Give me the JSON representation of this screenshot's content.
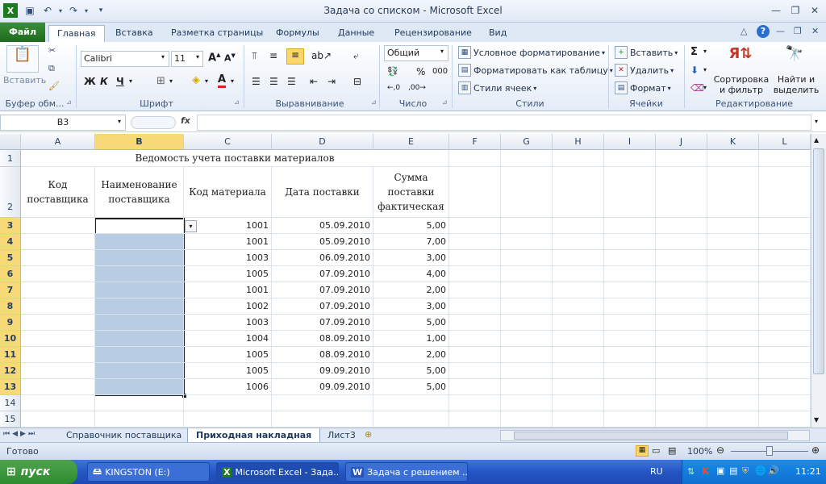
{
  "window": {
    "title": "Задача со списком - Microsoft Excel"
  },
  "tabs": [
    "Файл",
    "Главная",
    "Вставка",
    "Разметка страницы",
    "Формулы",
    "Данные",
    "Рецензирование",
    "Вид"
  ],
  "ribbon": {
    "clipboard": {
      "paste": "Вставить",
      "label": "Буфер обм..."
    },
    "font": {
      "name": "Calibri",
      "size": "11",
      "bold": "Ж",
      "italic": "К",
      "underline": "Ч",
      "label": "Шрифт"
    },
    "alignment": {
      "label": "Выравнивание"
    },
    "number": {
      "format": "Общий",
      "label": "Число"
    },
    "styles": {
      "cond": "Условное форматирование",
      "table": "Форматировать как таблицу",
      "cell": "Стили ячеек",
      "label": "Стили"
    },
    "cells": {
      "insert": "Вставить",
      "delete": "Удалить",
      "format": "Формат",
      "label": "Ячейки"
    },
    "editing": {
      "sort1": "Сортировка",
      "sort2": "и фильтр",
      "find1": "Найти и",
      "find2": "выделить",
      "label": "Редактирование"
    }
  },
  "formula": {
    "namebox": "B3",
    "fx": "fx",
    "value": ""
  },
  "columns": [
    "A",
    "B",
    "C",
    "D",
    "E",
    "F",
    "G",
    "H",
    "I",
    "J",
    "K",
    "L"
  ],
  "sheet": {
    "title": "Ведомость учета поставки материалов",
    "headers": {
      "a": "Код поставщика",
      "b": "Наименование поставщика",
      "c": "Код материала",
      "d": "Дата поставки",
      "e": "Сумма поставки фактическая"
    },
    "rows": [
      {
        "c": "1001",
        "d": "05.09.2010",
        "e": "5,00"
      },
      {
        "c": "1001",
        "d": "05.09.2010",
        "e": "7,00"
      },
      {
        "c": "1003",
        "d": "06.09.2010",
        "e": "3,00"
      },
      {
        "c": "1005",
        "d": "07.09.2010",
        "e": "4,00"
      },
      {
        "c": "1001",
        "d": "07.09.2010",
        "e": "2,00"
      },
      {
        "c": "1002",
        "d": "07.09.2010",
        "e": "3,00"
      },
      {
        "c": "1003",
        "d": "07.09.2010",
        "e": "5,00"
      },
      {
        "c": "1004",
        "d": "08.09.2010",
        "e": "1,00"
      },
      {
        "c": "1005",
        "d": "08.09.2010",
        "e": "2,00"
      },
      {
        "c": "1005",
        "d": "09.09.2010",
        "e": "5,00"
      },
      {
        "c": "1006",
        "d": "09.09.2010",
        "e": "5,00"
      }
    ],
    "row_numbers": [
      "1",
      "2",
      "3",
      "4",
      "5",
      "6",
      "7",
      "8",
      "9",
      "10",
      "11",
      "12",
      "13",
      "14",
      "15"
    ]
  },
  "sheet_tabs": [
    "Справочник поставщика",
    "Приходная накладная",
    "Лист3"
  ],
  "status": {
    "ready": "Готово",
    "zoom": "100%"
  },
  "taskbar": {
    "start": "пуск",
    "items": [
      "KINGSTON (E:)",
      "Microsoft Excel - Зада...",
      "Задача с решением ..."
    ],
    "lang": "RU",
    "time": "11:21"
  }
}
